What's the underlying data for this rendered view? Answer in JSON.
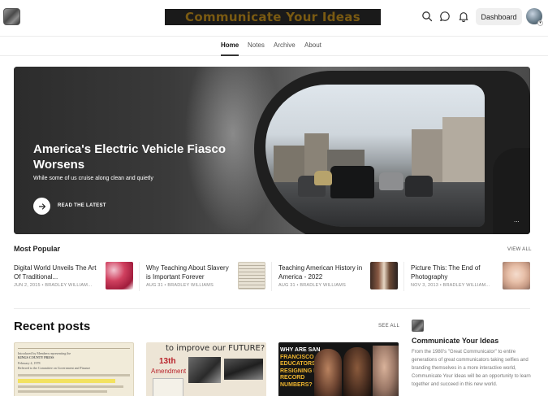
{
  "header": {
    "publication_title": "Communicate Your Ideas",
    "dashboard_label": "Dashboard",
    "icons": [
      "search-icon",
      "chat-icon",
      "bell-icon"
    ]
  },
  "nav": {
    "items": [
      {
        "label": "Home",
        "active": true
      },
      {
        "label": "Notes",
        "active": false
      },
      {
        "label": "Archive",
        "active": false
      },
      {
        "label": "About",
        "active": false
      }
    ]
  },
  "hero": {
    "title": "America's Electric Vehicle Fiasco Worsens",
    "subtitle": "While some of us cruise along clean and quietly",
    "cta_label": "READ THE LATEST",
    "more_label": "..."
  },
  "most_popular": {
    "title": "Most Popular",
    "view_all": "VIEW ALL",
    "items": [
      {
        "title": "Digital World Unveils The Art Of Traditional...",
        "meta": "JUN 2, 2015 • BRADLEY WILLIAM..."
      },
      {
        "title": "Why Teaching About Slavery is Important Forever",
        "meta": "AUG 31 • BRADLEY WILLIAMS"
      },
      {
        "title": "Teaching American History in America - 2022",
        "meta": "AUG 31 • BRADLEY WILLIAMS"
      },
      {
        "title": "Picture This: The End of Photography",
        "meta": "NOV 3, 2013 • BRADLEY WILLIAM..."
      }
    ]
  },
  "recent_posts": {
    "title": "Recent posts",
    "see_all": "SEE ALL",
    "card_texts": {
      "card2_handwriting_1": "to improve our FUTURE?",
      "card2_handwriting_2": "13th",
      "card2_handwriting_3": "Amendment",
      "card3_line1": "WHY ARE SAN",
      "card3_line2": "FRANCISCO",
      "card3_line3": "EDUCATORS",
      "card3_line4": "RESIGNING IN",
      "card3_line5": "RECORD",
      "card3_line6": "NUMBERS?"
    },
    "card1_doc": {
      "line1": "Introduced by Members representing the",
      "line2": "KINGS COUNTY PRESS",
      "line3": "February 4, 1978",
      "line4": "Referred to the Committee on Government and Finance"
    }
  },
  "sidebar": {
    "title": "Communicate Your Ideas",
    "description": "From the 1980's \"Great Communicator\" to entire generations of great communicators taking selfies and branding themselves in a more interactive world, Communicate Your Ideas will be an opportunity to learn together and succeed in this new world."
  }
}
